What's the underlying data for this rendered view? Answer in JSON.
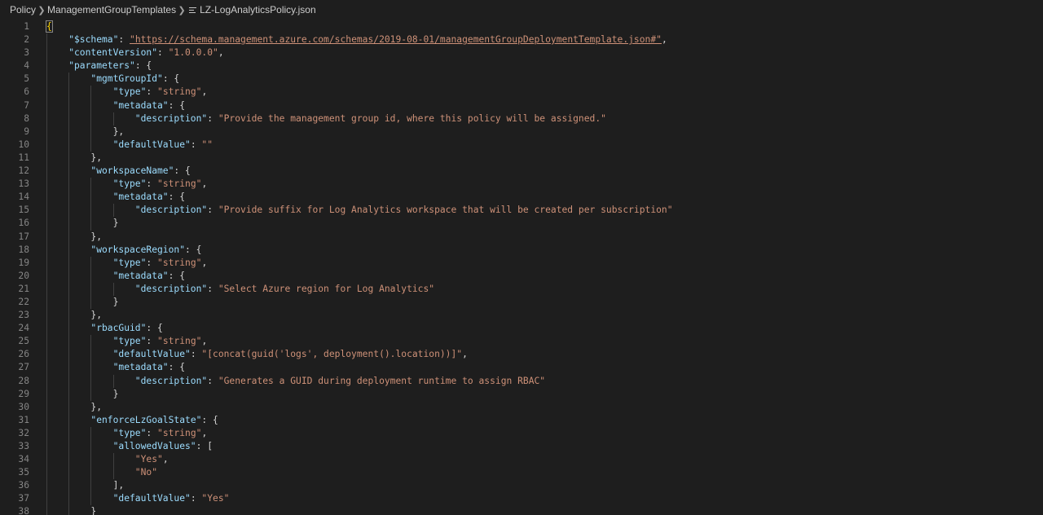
{
  "breadcrumb": {
    "items": [
      "Policy",
      "ManagementGroupTemplates",
      "LZ-LogAnalyticsPolicy.json"
    ]
  },
  "editor": {
    "lines": [
      {
        "n": "1",
        "indent": 0,
        "tokens": [
          [
            "y",
            "{"
          ]
        ]
      },
      {
        "n": "2",
        "indent": 1,
        "tokens": [
          [
            "k",
            "\"$schema\""
          ],
          [
            "p",
            ": "
          ],
          [
            "u",
            "\"https://schema.management.azure.com/schemas/2019-08-01/managementGroupDeploymentTemplate.json#\""
          ],
          [
            "p",
            ","
          ]
        ]
      },
      {
        "n": "3",
        "indent": 1,
        "tokens": [
          [
            "k",
            "\"contentVersion\""
          ],
          [
            "p",
            ": "
          ],
          [
            "s",
            "\"1.0.0.0\""
          ],
          [
            "p",
            ","
          ]
        ]
      },
      {
        "n": "4",
        "indent": 1,
        "tokens": [
          [
            "k",
            "\"parameters\""
          ],
          [
            "p",
            ": {"
          ]
        ]
      },
      {
        "n": "5",
        "indent": 2,
        "tokens": [
          [
            "k",
            "\"mgmtGroupId\""
          ],
          [
            "p",
            ": {"
          ]
        ]
      },
      {
        "n": "6",
        "indent": 3,
        "tokens": [
          [
            "k",
            "\"type\""
          ],
          [
            "p",
            ": "
          ],
          [
            "s",
            "\"string\""
          ],
          [
            "p",
            ","
          ]
        ]
      },
      {
        "n": "7",
        "indent": 3,
        "tokens": [
          [
            "k",
            "\"metadata\""
          ],
          [
            "p",
            ": {"
          ]
        ]
      },
      {
        "n": "8",
        "indent": 4,
        "tokens": [
          [
            "k",
            "\"description\""
          ],
          [
            "p",
            ": "
          ],
          [
            "s",
            "\"Provide the management group id, where this policy will be assigned.\""
          ]
        ]
      },
      {
        "n": "9",
        "indent": 3,
        "tokens": [
          [
            "p",
            "},"
          ]
        ]
      },
      {
        "n": "10",
        "indent": 3,
        "tokens": [
          [
            "k",
            "\"defaultValue\""
          ],
          [
            "p",
            ": "
          ],
          [
            "s",
            "\"\""
          ]
        ]
      },
      {
        "n": "11",
        "indent": 2,
        "tokens": [
          [
            "p",
            "},"
          ]
        ]
      },
      {
        "n": "12",
        "indent": 2,
        "tokens": [
          [
            "k",
            "\"workspaceName\""
          ],
          [
            "p",
            ": {"
          ]
        ]
      },
      {
        "n": "13",
        "indent": 3,
        "tokens": [
          [
            "k",
            "\"type\""
          ],
          [
            "p",
            ": "
          ],
          [
            "s",
            "\"string\""
          ],
          [
            "p",
            ","
          ]
        ]
      },
      {
        "n": "14",
        "indent": 3,
        "tokens": [
          [
            "k",
            "\"metadata\""
          ],
          [
            "p",
            ": {"
          ]
        ]
      },
      {
        "n": "15",
        "indent": 4,
        "tokens": [
          [
            "k",
            "\"description\""
          ],
          [
            "p",
            ": "
          ],
          [
            "s",
            "\"Provide suffix for Log Analytics workspace that will be created per subscription\""
          ]
        ]
      },
      {
        "n": "16",
        "indent": 3,
        "tokens": [
          [
            "p",
            "}"
          ]
        ]
      },
      {
        "n": "17",
        "indent": 2,
        "tokens": [
          [
            "p",
            "},"
          ]
        ]
      },
      {
        "n": "18",
        "indent": 2,
        "tokens": [
          [
            "k",
            "\"workspaceRegion\""
          ],
          [
            "p",
            ": {"
          ]
        ]
      },
      {
        "n": "19",
        "indent": 3,
        "tokens": [
          [
            "k",
            "\"type\""
          ],
          [
            "p",
            ": "
          ],
          [
            "s",
            "\"string\""
          ],
          [
            "p",
            ","
          ]
        ]
      },
      {
        "n": "20",
        "indent": 3,
        "tokens": [
          [
            "k",
            "\"metadata\""
          ],
          [
            "p",
            ": {"
          ]
        ]
      },
      {
        "n": "21",
        "indent": 4,
        "tokens": [
          [
            "k",
            "\"description\""
          ],
          [
            "p",
            ": "
          ],
          [
            "s",
            "\"Select Azure region for Log Analytics\""
          ]
        ]
      },
      {
        "n": "22",
        "indent": 3,
        "tokens": [
          [
            "p",
            "}"
          ]
        ]
      },
      {
        "n": "23",
        "indent": 2,
        "tokens": [
          [
            "p",
            "},"
          ]
        ]
      },
      {
        "n": "24",
        "indent": 2,
        "tokens": [
          [
            "k",
            "\"rbacGuid\""
          ],
          [
            "p",
            ": {"
          ]
        ]
      },
      {
        "n": "25",
        "indent": 3,
        "tokens": [
          [
            "k",
            "\"type\""
          ],
          [
            "p",
            ": "
          ],
          [
            "s",
            "\"string\""
          ],
          [
            "p",
            ","
          ]
        ]
      },
      {
        "n": "26",
        "indent": 3,
        "tokens": [
          [
            "k",
            "\"defaultValue\""
          ],
          [
            "p",
            ": "
          ],
          [
            "s",
            "\"[concat(guid('logs', deployment().location))]\""
          ],
          [
            "p",
            ","
          ]
        ]
      },
      {
        "n": "27",
        "indent": 3,
        "tokens": [
          [
            "k",
            "\"metadata\""
          ],
          [
            "p",
            ": {"
          ]
        ]
      },
      {
        "n": "28",
        "indent": 4,
        "tokens": [
          [
            "k",
            "\"description\""
          ],
          [
            "p",
            ": "
          ],
          [
            "s",
            "\"Generates a GUID during deployment runtime to assign RBAC\""
          ]
        ]
      },
      {
        "n": "29",
        "indent": 3,
        "tokens": [
          [
            "p",
            "}"
          ]
        ]
      },
      {
        "n": "30",
        "indent": 2,
        "tokens": [
          [
            "p",
            "},"
          ]
        ]
      },
      {
        "n": "31",
        "indent": 2,
        "tokens": [
          [
            "k",
            "\"enforceLzGoalState\""
          ],
          [
            "p",
            ": {"
          ]
        ]
      },
      {
        "n": "32",
        "indent": 3,
        "tokens": [
          [
            "k",
            "\"type\""
          ],
          [
            "p",
            ": "
          ],
          [
            "s",
            "\"string\""
          ],
          [
            "p",
            ","
          ]
        ]
      },
      {
        "n": "33",
        "indent": 3,
        "tokens": [
          [
            "k",
            "\"allowedValues\""
          ],
          [
            "p",
            ": ["
          ]
        ]
      },
      {
        "n": "34",
        "indent": 4,
        "tokens": [
          [
            "s",
            "\"Yes\""
          ],
          [
            "p",
            ","
          ]
        ]
      },
      {
        "n": "35",
        "indent": 4,
        "tokens": [
          [
            "s",
            "\"No\""
          ]
        ]
      },
      {
        "n": "36",
        "indent": 3,
        "tokens": [
          [
            "p",
            "],"
          ]
        ]
      },
      {
        "n": "37",
        "indent": 3,
        "tokens": [
          [
            "k",
            "\"defaultValue\""
          ],
          [
            "p",
            ": "
          ],
          [
            "s",
            "\"Yes\""
          ]
        ]
      },
      {
        "n": "38",
        "indent": 2,
        "tokens": [
          [
            "p",
            "}"
          ]
        ]
      }
    ]
  }
}
